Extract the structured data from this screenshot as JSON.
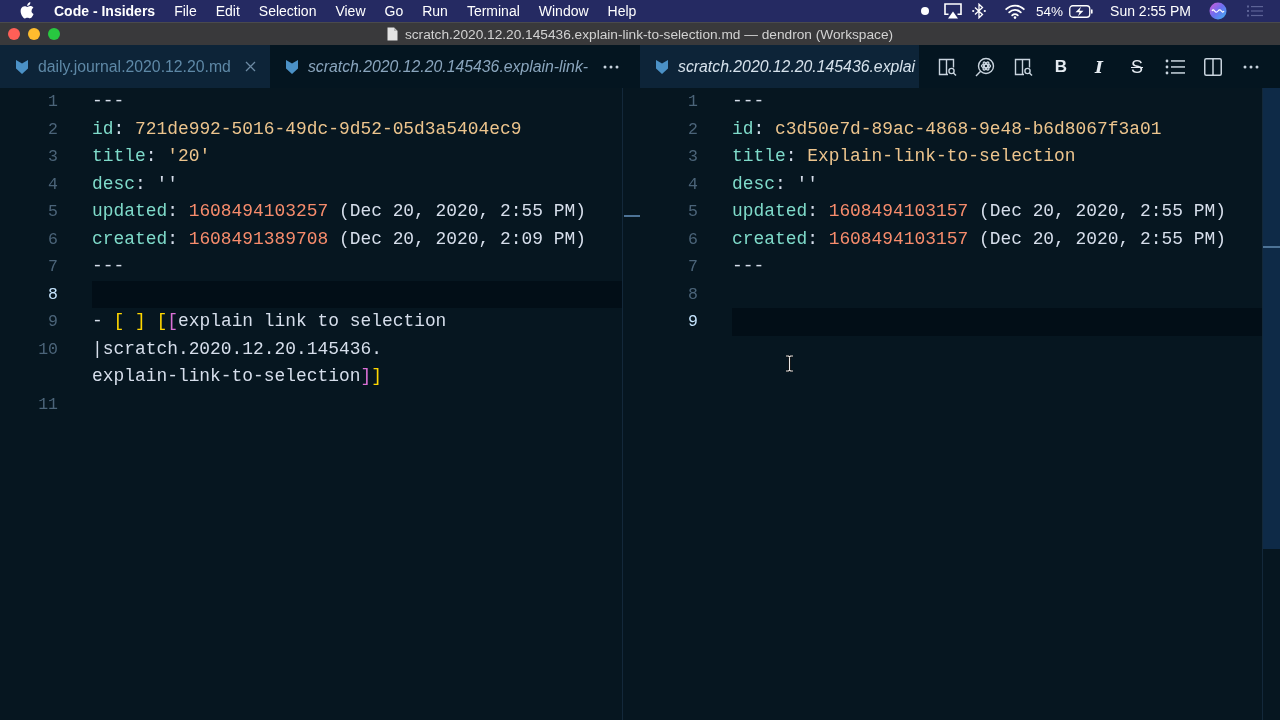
{
  "menu_bar": {
    "app_name": "Code - Insiders",
    "menus": [
      "File",
      "Edit",
      "Selection",
      "View",
      "Go",
      "Run",
      "Terminal",
      "Window",
      "Help"
    ],
    "battery_percent": "54%",
    "battery_charging": true,
    "clock": "Sun 2:55 PM"
  },
  "window": {
    "title": "scratch.2020.12.20.145436.explain-link-to-selection.md — dendron (Workspace)"
  },
  "editor_groups": [
    {
      "focused": false,
      "tabs": [
        {
          "label": "daily.journal.2020.12.20.md",
          "selected": true,
          "preview": false,
          "close_button": true
        },
        {
          "label": "scratch.2020.12.20.145436.explain-link-",
          "selected": false,
          "preview": true,
          "close_button": false
        }
      ],
      "toolbar": [
        {
          "kind": "more"
        }
      ],
      "lines": [
        {
          "number": "1",
          "current": false,
          "rows": [
            [
              {
                "kind": "text",
                "text": "---"
              }
            ]
          ]
        },
        {
          "number": "2",
          "current": false,
          "rows": [
            [
              {
                "kind": "key",
                "text": "id"
              },
              {
                "kind": "text",
                "text": ": "
              },
              {
                "kind": "string",
                "text": "721de992-5016-49dc-9d52-05d3a5404ec9"
              }
            ]
          ]
        },
        {
          "number": "3",
          "current": false,
          "rows": [
            [
              {
                "kind": "key",
                "text": "title"
              },
              {
                "kind": "text",
                "text": ": "
              },
              {
                "kind": "string",
                "text": "'20'"
              }
            ]
          ]
        },
        {
          "number": "4",
          "current": false,
          "rows": [
            [
              {
                "kind": "key",
                "text": "desc"
              },
              {
                "kind": "text",
                "text": ": ''"
              }
            ]
          ]
        },
        {
          "number": "5",
          "current": false,
          "rows": [
            [
              {
                "kind": "key",
                "text": "updated"
              },
              {
                "kind": "text",
                "text": ": "
              },
              {
                "kind": "number",
                "text": "1608494103257"
              },
              {
                "kind": "text",
                "text": " (Dec 20, 2020, 2:55 PM)"
              }
            ]
          ]
        },
        {
          "number": "6",
          "current": false,
          "rows": [
            [
              {
                "kind": "key",
                "text": "created"
              },
              {
                "kind": "text",
                "text": ": "
              },
              {
                "kind": "number",
                "text": "1608491389708"
              },
              {
                "kind": "text",
                "text": " (Dec 20, 2020, 2:09 PM)"
              }
            ]
          ]
        },
        {
          "number": "7",
          "current": false,
          "rows": [
            [
              {
                "kind": "text",
                "text": "---"
              }
            ]
          ]
        },
        {
          "number": "8",
          "current": true
        },
        {
          "number": "9",
          "current": false,
          "rows": [
            [
              {
                "kind": "text",
                "text": "- "
              },
              {
                "kind": "bracket",
                "text": "[ ]"
              },
              {
                "kind": "text",
                "text": " "
              },
              {
                "kind": "bracket",
                "text": "["
              },
              {
                "kind": "nested",
                "text": "["
              },
              {
                "kind": "text",
                "text": "explain link to selection"
              }
            ]
          ]
        },
        {
          "number": "10",
          "current": false,
          "rows": [
            [
              {
                "kind": "text",
                "text": "|scratch.2020.12.20.145436."
              }
            ],
            [
              {
                "kind": "text",
                "text": "explain-link-to-selection"
              },
              {
                "kind": "nested",
                "text": "]"
              },
              {
                "kind": "bracket",
                "text": "]"
              }
            ]
          ]
        },
        {
          "number": "11",
          "current": false
        }
      ]
    },
    {
      "focused": true,
      "tabs": [
        {
          "label": "scratch.2020.12.20.145436.explai",
          "selected": true,
          "preview": true,
          "close_button": false
        }
      ],
      "toolbar": [
        {
          "kind": "preview"
        },
        {
          "kind": "lookup"
        },
        {
          "kind": "preview"
        },
        {
          "kind": "bold",
          "label": "B"
        },
        {
          "kind": "italic",
          "label": "I"
        },
        {
          "kind": "strike",
          "label": "S"
        },
        {
          "kind": "list"
        },
        {
          "kind": "split"
        },
        {
          "kind": "more"
        }
      ],
      "lines": [
        {
          "number": "1",
          "current": false,
          "rows": [
            [
              {
                "kind": "text",
                "text": "---"
              }
            ]
          ]
        },
        {
          "number": "2",
          "current": false,
          "rows": [
            [
              {
                "kind": "key",
                "text": "id"
              },
              {
                "kind": "text",
                "text": ": "
              },
              {
                "kind": "string",
                "text": "c3d50e7d-89ac-4868-9e48-b6d8067f3a01"
              }
            ]
          ]
        },
        {
          "number": "3",
          "current": false,
          "rows": [
            [
              {
                "kind": "key",
                "text": "title"
              },
              {
                "kind": "text",
                "text": ": "
              },
              {
                "kind": "string",
                "text": "Explain-link-to-selection"
              }
            ]
          ]
        },
        {
          "number": "4",
          "current": false,
          "rows": [
            [
              {
                "kind": "key",
                "text": "desc"
              },
              {
                "kind": "text",
                "text": ": ''"
              }
            ]
          ]
        },
        {
          "number": "5",
          "current": false,
          "rows": [
            [
              {
                "kind": "key",
                "text": "updated"
              },
              {
                "kind": "text",
                "text": ": "
              },
              {
                "kind": "number",
                "text": "1608494103157"
              },
              {
                "kind": "text",
                "text": " (Dec 20, 2020, 2:55 PM)"
              }
            ]
          ]
        },
        {
          "number": "6",
          "current": false,
          "rows": [
            [
              {
                "kind": "key",
                "text": "created"
              },
              {
                "kind": "text",
                "text": ": "
              },
              {
                "kind": "number",
                "text": "1608494103157"
              },
              {
                "kind": "text",
                "text": " (Dec 20, 2020, 2:55 PM)"
              }
            ]
          ]
        },
        {
          "number": "7",
          "current": false,
          "rows": [
            [
              {
                "kind": "text",
                "text": "---"
              }
            ]
          ]
        },
        {
          "number": "8",
          "current": false
        },
        {
          "number": "9",
          "current": true
        }
      ]
    }
  ]
}
